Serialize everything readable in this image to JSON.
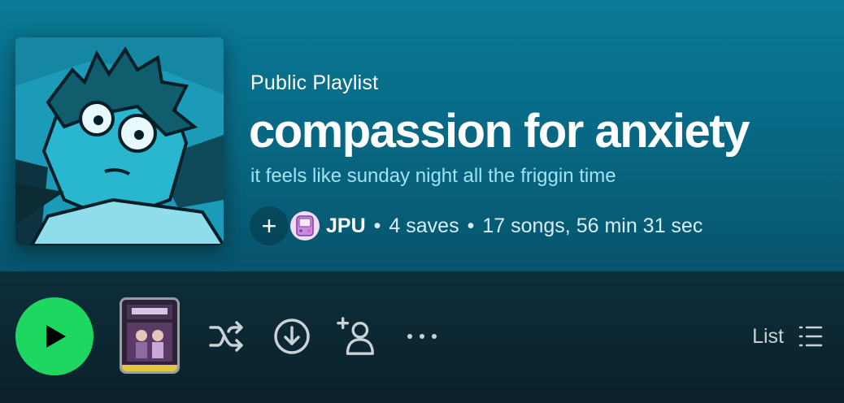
{
  "playlist": {
    "type_label": "Public Playlist",
    "title": "compassion for anxiety",
    "description": "it feels like sunday night all the friggin time",
    "owner": "JPU",
    "saves": "4 saves",
    "songs_duration": "17 songs, 56 min 31 sec",
    "separator": "•"
  },
  "header": {
    "add_button_glyph": "+",
    "add_icon": "plus-icon",
    "avatar_icon": "handheld-console-avatar"
  },
  "actions": {
    "play_icon": "play-icon",
    "shuffle_icon": "shuffle-icon",
    "download_icon": "download-icon",
    "add_user_icon": "add-user-icon",
    "more_icon": "more-icon",
    "more_glyph": "• • •",
    "view_mode_label": "List",
    "view_mode_icon": "list-icon"
  },
  "colors": {
    "play_accent": "#1ed760",
    "description": "#9fe3f4",
    "header_bg": "#0a7a96"
  }
}
